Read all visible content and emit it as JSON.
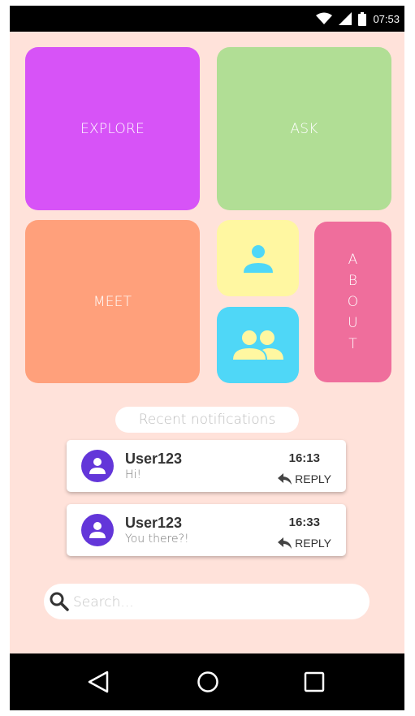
{
  "status_bar": {
    "time": "07:53",
    "icons": [
      "wifi-icon",
      "signal-icon",
      "battery-icon"
    ]
  },
  "tiles": {
    "explore": "EXPLORE",
    "ask": "ASK",
    "meet": "MEET",
    "about_letters": [
      "A",
      "B",
      "O",
      "U",
      "T"
    ],
    "person_icon": "person-icon",
    "group_icon": "group-icon"
  },
  "colors": {
    "background": "#ffe2da",
    "explore": "#d753f7",
    "ask": "#b1de95",
    "meet": "#ffa07b",
    "person": "#fff7a1",
    "group": "#4fd7f7",
    "about": "#ef6e9c",
    "avatar": "#6336d9"
  },
  "notifications": {
    "header": "Recent notifications",
    "items": [
      {
        "user": "User123",
        "message": "Hi!",
        "time": "16:13",
        "reply": "REPLY"
      },
      {
        "user": "User123",
        "message": "You there?!",
        "time": "16:33",
        "reply": "REPLY"
      }
    ]
  },
  "search": {
    "placeholder": "Search..."
  },
  "nav_bar": {
    "icons": [
      "back-icon",
      "home-icon",
      "recents-icon"
    ]
  }
}
